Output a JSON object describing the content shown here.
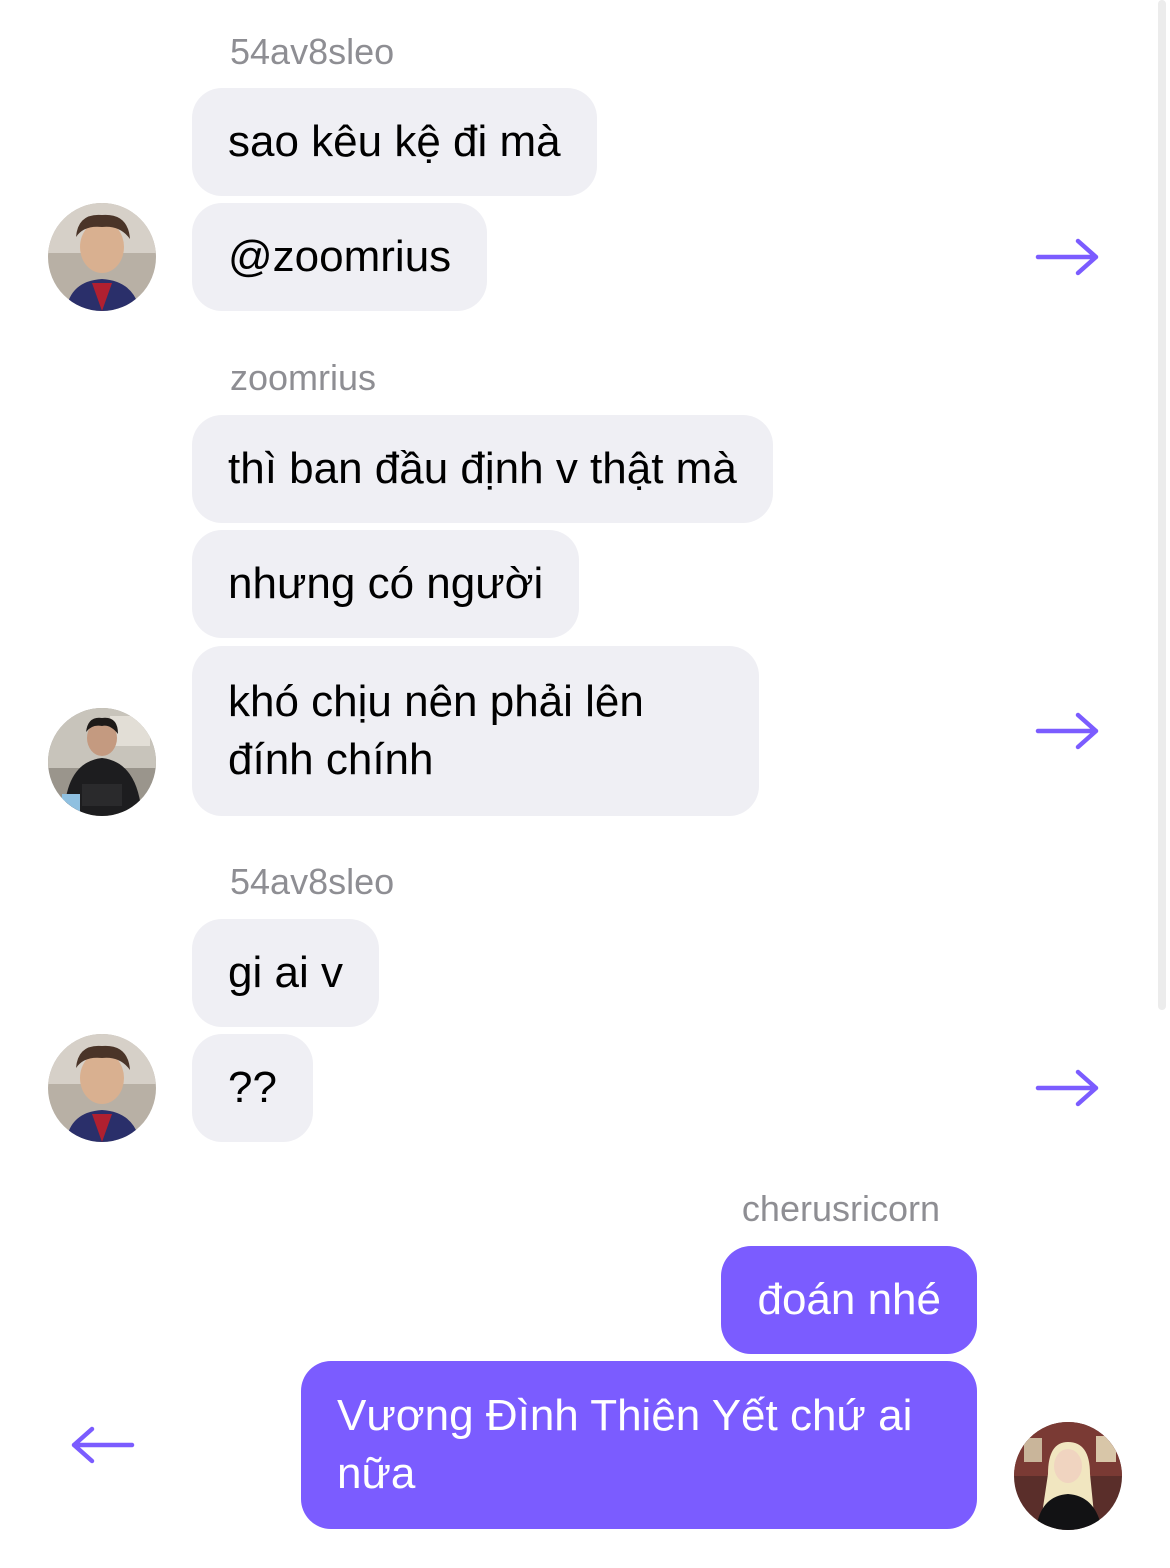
{
  "messages": [
    {
      "sender": "54av8sleo",
      "lines": [
        "sao kêu kệ đi mà",
        "@zoomrius"
      ]
    },
    {
      "sender": "zoomrius",
      "lines": [
        "thì ban đầu định v thật mà",
        "nhưng có người",
        "khó chịu nên phải lên đính chính"
      ]
    },
    {
      "sender": "54av8sleo",
      "lines": [
        "gi ai v",
        "??"
      ]
    },
    {
      "sender": "cherusricorn",
      "lines": [
        "đoán nhé",
        "Vương Đình Thiên Yết chứ ai nữa"
      ]
    }
  ],
  "colors": {
    "accent": "#7b5cff",
    "incoming_bubble": "#efeff4",
    "sender_name": "#8e8e93"
  },
  "icons": {
    "forward": "arrow-right-icon",
    "reply": "arrow-left-icon"
  }
}
